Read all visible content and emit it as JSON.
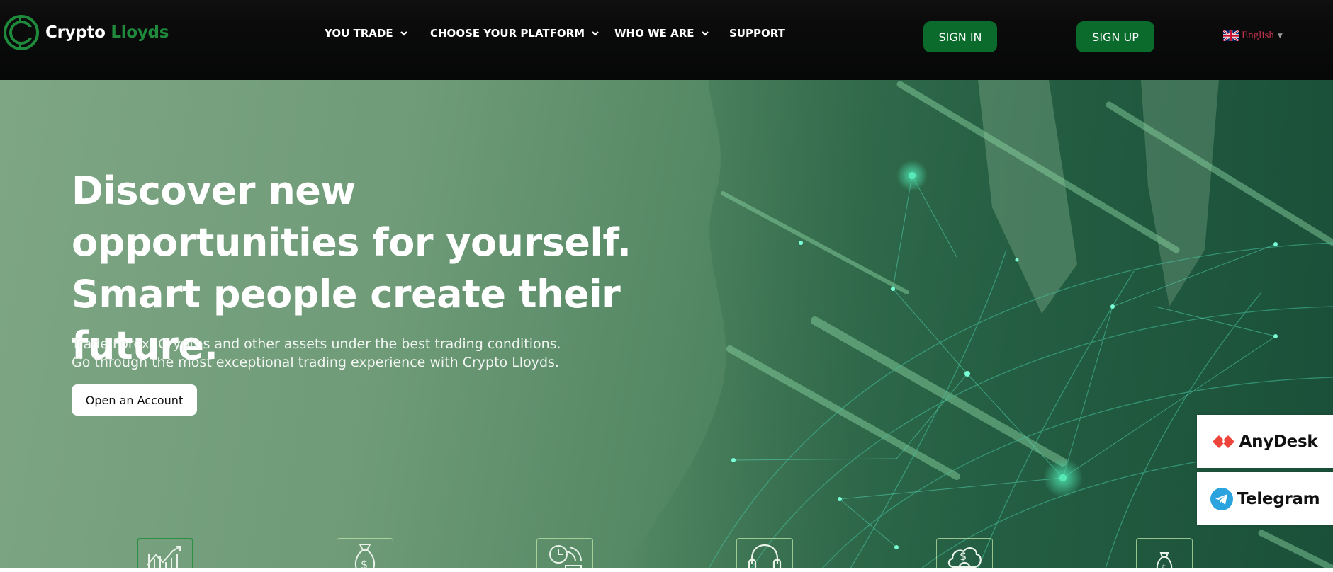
{
  "brand": {
    "name_part1": "Crypto",
    "name_part2": "Lloyds",
    "accent": "#1f8a3c"
  },
  "nav": {
    "items": [
      {
        "label": "YOU TRADE",
        "has_dropdown": true
      },
      {
        "label": "CHOOSE YOUR PLATFORM",
        "has_dropdown": true
      },
      {
        "label": "WHO WE ARE",
        "has_dropdown": true
      },
      {
        "label": "SUPPORT",
        "has_dropdown": false
      }
    ]
  },
  "auth": {
    "sign_in": "SIGN IN",
    "sign_up": "SIGN UP",
    "button_color": "#0b6b2d"
  },
  "language": {
    "selected": "English",
    "icon": "uk-flag-icon"
  },
  "hero": {
    "title": "Discover new opportunities for yourself. Smart people create their future.",
    "subtitle_line1": "Trade Forex, Cryptos and other assets under the best trading conditions.",
    "subtitle_line2": "Go through the most exceptional trading experience with Crypto Lloyds.",
    "cta": "Open an Account"
  },
  "side_widgets": [
    {
      "label": "AnyDesk",
      "icon": "anydesk-icon"
    },
    {
      "label": "Telegram",
      "icon": "telegram-icon"
    }
  ],
  "features": [
    {
      "icon": "chart-growth-icon"
    },
    {
      "icon": "money-bag-icon"
    },
    {
      "icon": "clock-speed-icon"
    },
    {
      "icon": "headset-icon"
    },
    {
      "icon": "cloud-dollar-icon"
    },
    {
      "icon": "money-bag-small-icon"
    }
  ]
}
